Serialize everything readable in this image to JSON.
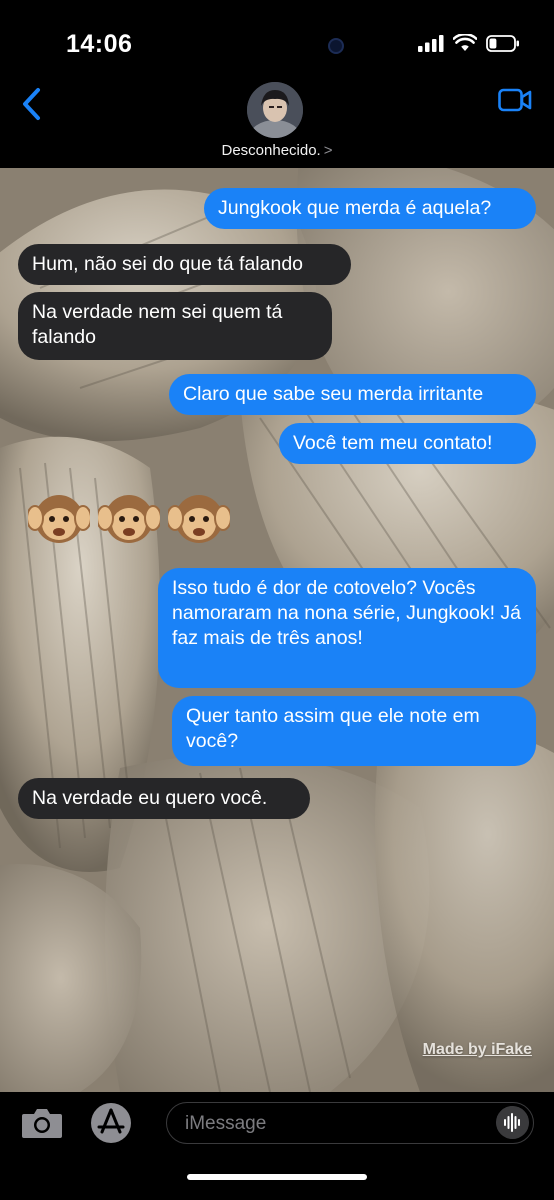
{
  "status_bar": {
    "time": "14:06",
    "battery_level": 0.3
  },
  "header": {
    "contact_name": "Desconhecido.",
    "chevron": ">",
    "back_icon": "chevron-left-icon",
    "video_icon": "video-camera-icon",
    "accent_color": "#1a82f7"
  },
  "messages": [
    {
      "side": "sent",
      "text": "Jungkook que merda é aquela?"
    },
    {
      "side": "received",
      "text": "Hum, não sei do que tá falando"
    },
    {
      "side": "received",
      "text": "Na verdade nem sei quem tá falando"
    },
    {
      "side": "sent",
      "text": "Claro que sabe seu merda irritante"
    },
    {
      "side": "sent",
      "text": "Você tem meu contato!"
    },
    {
      "side": "received-emoji",
      "text": "🙉🙉🙉"
    },
    {
      "side": "sent",
      "text": "Isso tudo é dor de cotovelo? Vocês namoraram na nona série, Jungkook! Já faz mais de três anos!"
    },
    {
      "side": "sent",
      "text": "Quer tanto assim que ele note em você?"
    },
    {
      "side": "received",
      "text": "Na verdade eu quero você."
    }
  ],
  "watermark": "Made by iFake",
  "composer": {
    "placeholder": "iMessage",
    "camera_icon": "camera-icon",
    "appstore_icon": "app-store-icon",
    "audio_icon": "audio-waveform-icon"
  },
  "colors": {
    "sent_bubble": "#1a82f7",
    "received_bubble": "#262628"
  }
}
